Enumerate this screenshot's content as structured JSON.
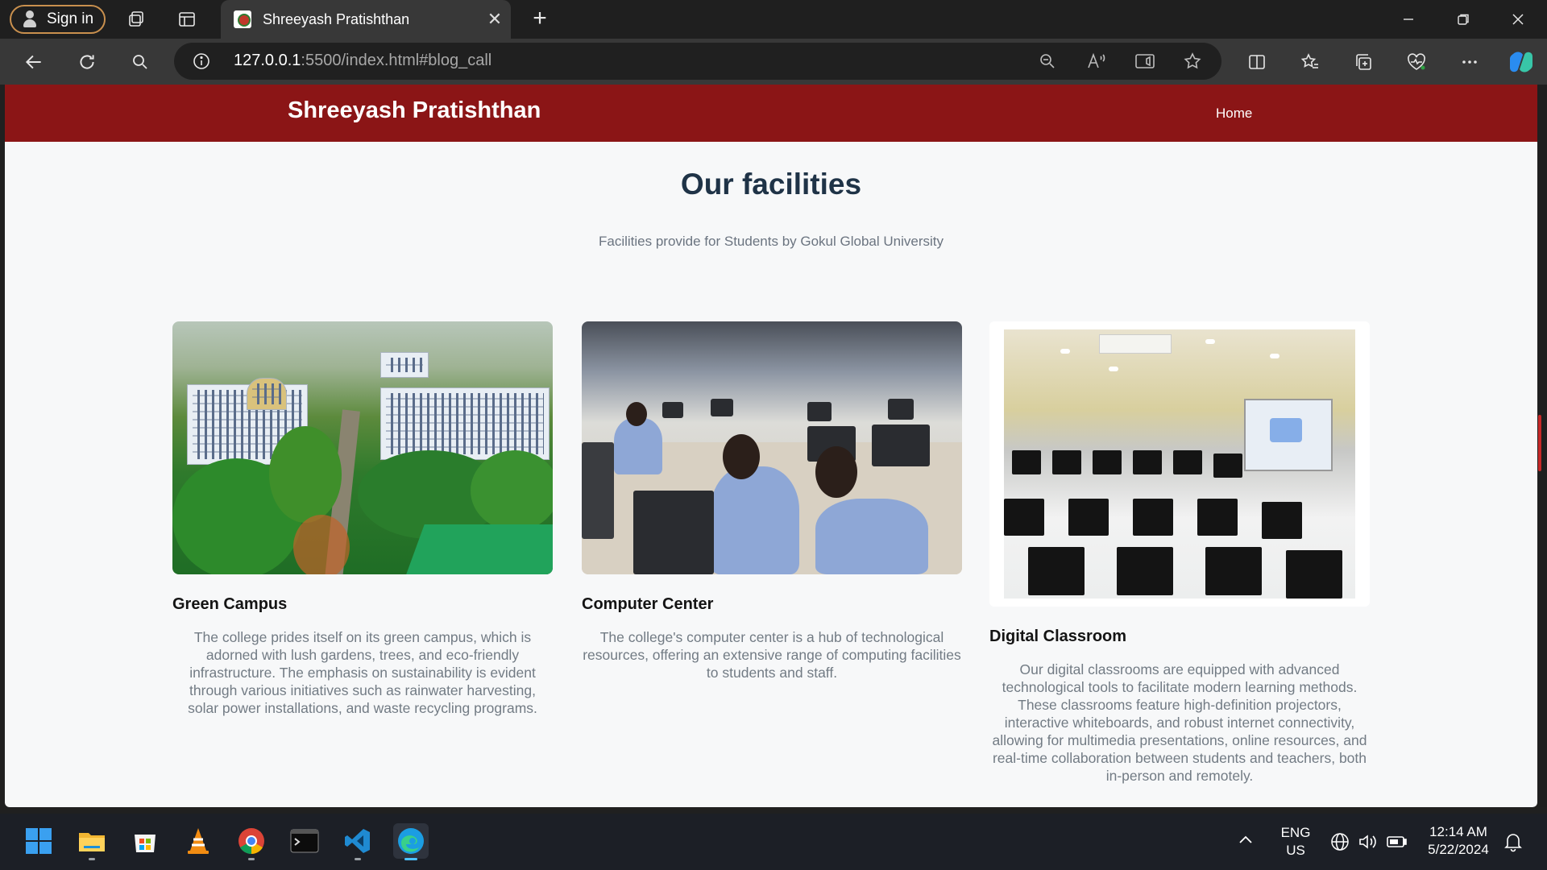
{
  "browser": {
    "signin_label": "Sign in",
    "tab_title": "Shreeyash Pratishthan",
    "url_host": "127.0.0.1",
    "url_rest": ":5500/index.html#blog_call"
  },
  "site": {
    "brand": "Shreeyash Pratishthan",
    "nav_home": "Home",
    "heading": "Our facilities",
    "subheading": "Facilities provide for Students by Gokul Global University"
  },
  "cards": [
    {
      "title": "Green Campus",
      "text": "The college prides itself on its green campus, which is adorned with lush gardens, trees, and eco-friendly infrastructure. The emphasis on sustainability is evident through various initiatives such as rainwater harvesting, solar power installations, and waste recycling programs."
    },
    {
      "title": "Computer Center",
      "text": "The college's computer center is a hub of technological resources, offering an extensive range of computing facilities to students and staff."
    },
    {
      "title": "Digital Classroom",
      "text": "Our digital classrooms are equipped with advanced technological tools to facilitate modern learning methods. These classrooms feature high-definition projectors, interactive whiteboards, and robust internet connectivity, allowing for multimedia presentations, online resources, and real-time collaboration between students and teachers, both in-person and remotely."
    }
  ],
  "taskbar": {
    "lang_line1": "ENG",
    "lang_line2": "US",
    "time": "12:14 AM",
    "date": "5/22/2024"
  },
  "colors": {
    "navbar": "#8b1516",
    "heading": "#1f3347",
    "body_text": "#727b84"
  }
}
